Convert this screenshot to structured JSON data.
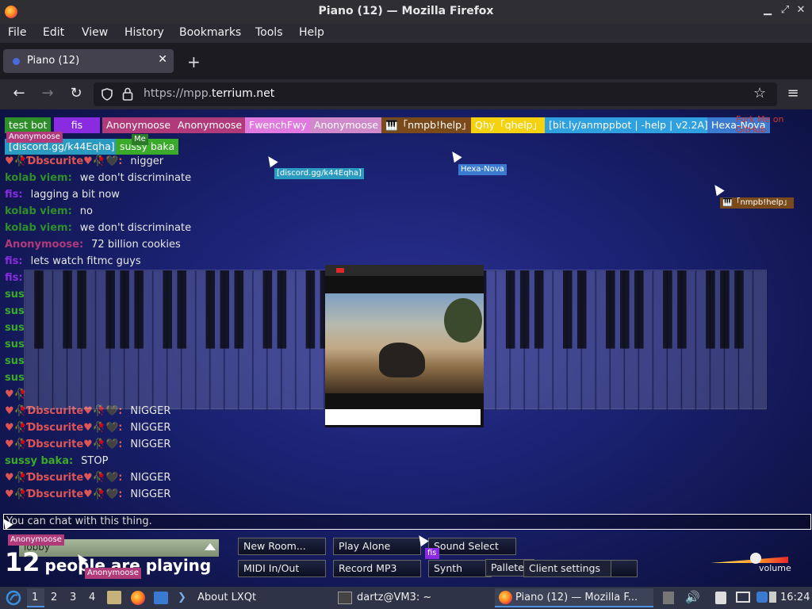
{
  "window": {
    "title": "Piano (12) — Mozilla Firefox"
  },
  "menu": {
    "file": "File",
    "edit": "Edit",
    "view": "View",
    "history": "History",
    "bookmarks": "Bookmarks",
    "tools": "Tools",
    "help": "Help"
  },
  "tab": {
    "label": "Piano (12)"
  },
  "url": {
    "prefix": "https://mpp.",
    "domain": "terrium.net"
  },
  "fork_me": "Fork Me on GitHub",
  "participants": [
    {
      "name": "test bot",
      "color": "#2e8f2a"
    },
    {
      "name": "fis",
      "color": "#8a2be2"
    },
    {
      "name": "Anonymoose",
      "color": "#b03a7a"
    },
    {
      "name": "Anonymoose",
      "color": "#b03a7a"
    },
    {
      "name": "FwenchFwy",
      "color": "#e07ae0"
    },
    {
      "name": "Anonymoose",
      "color": "#d08acc"
    },
    {
      "name": "🎹「nmpb!help」",
      "color": "#7a4a1a"
    },
    {
      "name": "Qhy「qhelp」",
      "color": "#f5d210"
    },
    {
      "name": "[bit.ly/anmppbot | -help | v2.2A]",
      "color": "#2fa0e0"
    },
    {
      "name": "Hexa-Nova",
      "color": "#3a7ad0"
    },
    {
      "name": "[discord.gg/k44Eqha]",
      "color": "#2a9ac0"
    },
    {
      "name": "sussy baka",
      "color": "#3aaa2a"
    }
  ],
  "cursor_tags": {
    "anon1": "Anonymoose",
    "me": "Me",
    "discord": "[discord.gg/k44Eqha]",
    "hexa": "Hexa-Nova",
    "nmpb": "🎹「nmpb!help」",
    "fis": "fis",
    "anon2": "Anonymoose",
    "anon3": "Anonymoose"
  },
  "chat": [
    {
      "name": "♥🥀Ɗbscurite♥🥀🖤:",
      "msg": "nigger",
      "color": "#d55"
    },
    {
      "name": "kolab viem:",
      "msg": "we don't discriminate",
      "color": "#2e8f2a"
    },
    {
      "name": "fis:",
      "msg": "lagging a bit now",
      "color": "#8a2be2"
    },
    {
      "name": "kolab viem:",
      "msg": "no",
      "color": "#2e8f2a"
    },
    {
      "name": "kolab viem:",
      "msg": "we don't discriminate",
      "color": "#2e8f2a"
    },
    {
      "name": "Anonymoose:",
      "msg": "72 billion cookies",
      "color": "#b03a7a"
    },
    {
      "name": "fis:",
      "msg": "lets watch fitmc guys",
      "color": "#8a2be2"
    },
    {
      "name": "fis:",
      "msg": "",
      "color": "#8a2be2"
    },
    {
      "name": "sus",
      "msg": "",
      "color": "#3aaa2a"
    },
    {
      "name": "sus",
      "msg": "",
      "color": "#3aaa2a"
    },
    {
      "name": "sus",
      "msg": "",
      "color": "#3aaa2a"
    },
    {
      "name": "sus",
      "msg": "",
      "color": "#3aaa2a"
    },
    {
      "name": "sus",
      "msg": "",
      "color": "#3aaa2a"
    },
    {
      "name": "sus",
      "msg": "",
      "color": "#3aaa2a"
    },
    {
      "name": "♥🥀",
      "msg": "",
      "color": "#d55"
    },
    {
      "name": "♥🥀Ɗbscurite♥🥀🖤:",
      "msg": "NIGGER",
      "color": "#d55"
    },
    {
      "name": "♥🥀Ɗbscurite♥🥀🖤:",
      "msg": "NIGGER",
      "color": "#d55"
    },
    {
      "name": "♥🥀Ɗbscurite♥🥀🖤:",
      "msg": "NIGGER",
      "color": "#d55"
    },
    {
      "name": "sussy baka:",
      "msg": "STOP",
      "color": "#3aaa2a"
    },
    {
      "name": "♥🥀Ɗbscurite♥🥀🖤:",
      "msg": "NIGGER",
      "color": "#d55"
    },
    {
      "name": "♥🥀Ɗbscurite♥🥀🖤:",
      "msg": "NIGGER",
      "color": "#d55"
    }
  ],
  "chat_input": {
    "placeholder": "You can chat with this thing."
  },
  "lobby": {
    "label": "lobby"
  },
  "people": {
    "count": "12",
    "text": "people are playing"
  },
  "buttons": {
    "new_room": "New Room...",
    "play_alone": "Play Alone",
    "sound_select": "Sound Select",
    "midi": "MIDI In/Out",
    "record": "Record MP3",
    "synth": "Synth",
    "pallete": "Pallete",
    "client_settings": "Client settings"
  },
  "volume": {
    "label": "volume"
  },
  "taskbar": {
    "ws1": "1",
    "ws2": "2",
    "ws3": "3",
    "ws4": "4",
    "about": "About LXQt",
    "terminal": "dartz@VM3: ~",
    "firefox": "Piano (12) — Mozilla F...",
    "clock": "16:24"
  }
}
